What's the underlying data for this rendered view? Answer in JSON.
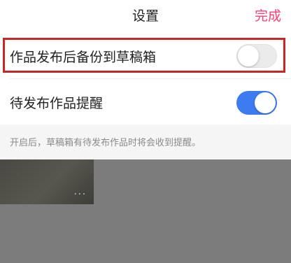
{
  "header": {
    "title": "设置",
    "done_label": "完成"
  },
  "settings": [
    {
      "label": "作品发布后备份到草稿箱",
      "enabled": false
    },
    {
      "label": "待发布作品提醒",
      "enabled": true
    }
  ],
  "hint": "开启后，草稿箱有待发布作品时将会收到提醒。",
  "thumbnail": {
    "more_label": "···"
  },
  "colors": {
    "accent": "#ff3d73",
    "toggle_on": "#3d7bf0",
    "highlight_border": "#c62828"
  }
}
